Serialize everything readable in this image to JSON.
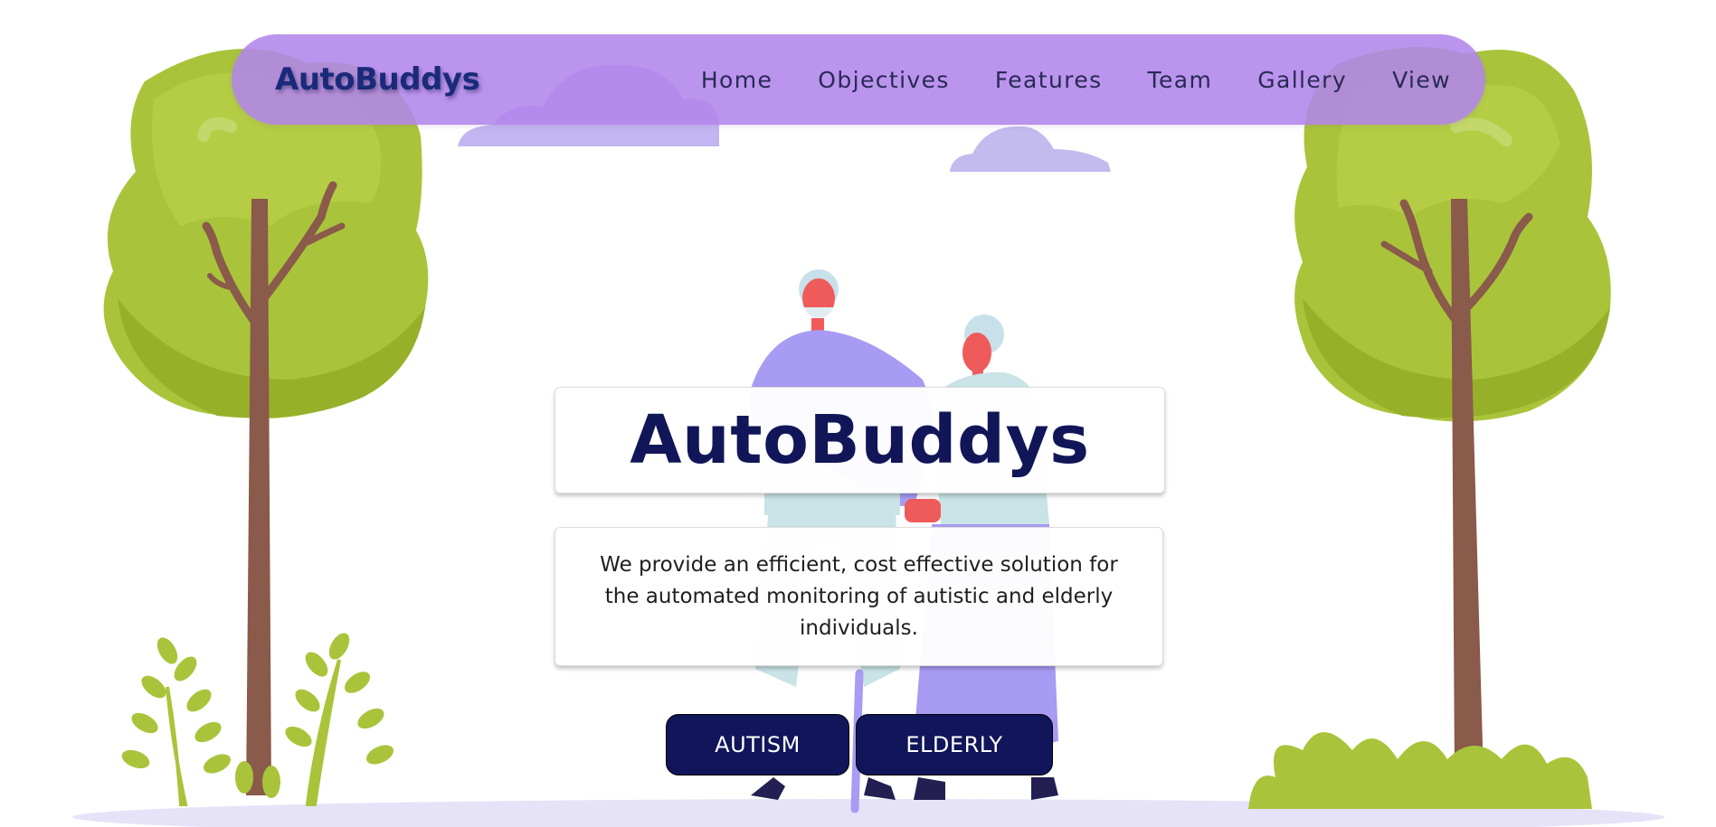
{
  "navbar": {
    "logo_text": "AutoBuddys",
    "links": [
      "Home",
      "Objectives",
      "Features",
      "Team",
      "Gallery",
      "View"
    ]
  },
  "hero": {
    "title": "AutoBuddys",
    "description": "We provide an efficient, cost effective solution for the automated monitoring of autistic and elderly individuals.",
    "buttons": {
      "autism": "AUTISM",
      "elderly": "ELDERLY"
    }
  },
  "colors": {
    "navbar_bg": "#b285eb",
    "title_text": "#111659",
    "button_bg": "#11155a",
    "tree_green": "#a9c43a",
    "trunk_brown": "#8a5a4a",
    "figure_purple": "#a79bf3"
  }
}
